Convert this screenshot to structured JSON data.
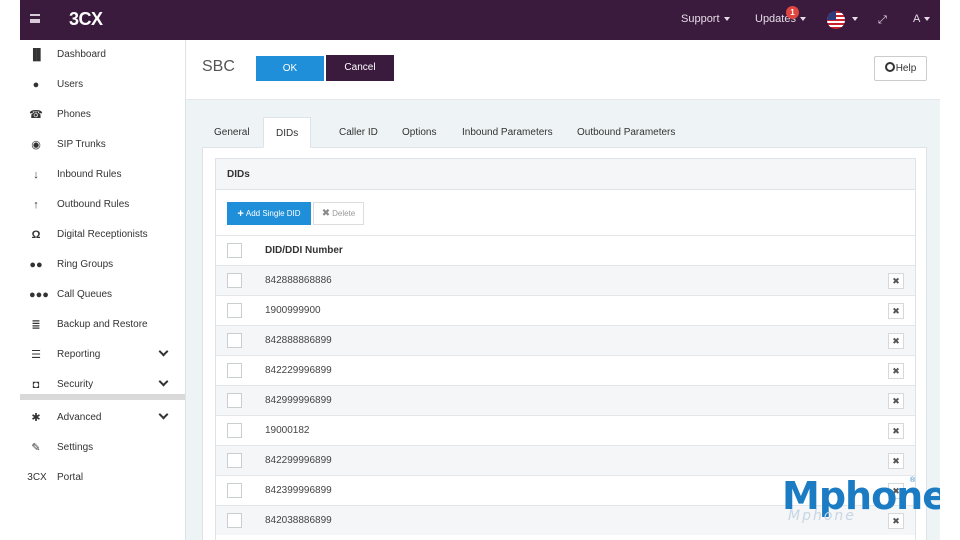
{
  "topbar": {
    "logo": "3CX",
    "support": "Support",
    "updates": "Updates",
    "updates_badge": "1",
    "user": "A",
    "expand_icon": "expand-icon",
    "flag_icon": "us-flag-icon"
  },
  "sidebar": {
    "items": [
      {
        "label": "Dashboard",
        "icon": "bar-chart-icon"
      },
      {
        "label": "Users",
        "icon": "user-icon"
      },
      {
        "label": "Phones",
        "icon": "phone-icon"
      },
      {
        "label": "SIP Trunks",
        "icon": "globe-icon"
      },
      {
        "label": "Inbound Rules",
        "icon": "arrow-down-icon"
      },
      {
        "label": "Outbound Rules",
        "icon": "arrow-up-icon"
      },
      {
        "label": "Digital Receptionists",
        "icon": "headset-icon"
      },
      {
        "label": "Ring Groups",
        "icon": "group-icon"
      },
      {
        "label": "Call Queues",
        "icon": "queue-icon"
      },
      {
        "label": "Backup and Restore",
        "icon": "database-icon"
      },
      {
        "label": "Reporting",
        "icon": "list-icon"
      },
      {
        "label": "Security",
        "icon": "shield-icon"
      },
      {
        "label": "Advanced",
        "icon": "cog-icon"
      },
      {
        "label": "Settings",
        "icon": "wrench-icon"
      },
      {
        "label": "Portal",
        "icon": "3cx-icon",
        "icon_text": "3CX"
      }
    ]
  },
  "page": {
    "title": "SBC",
    "ok": "OK",
    "cancel": "Cancel",
    "help": "Help"
  },
  "tabs": [
    "General",
    "DIDs",
    "Caller ID",
    "Options",
    "Inbound Parameters",
    "Outbound Parameters"
  ],
  "active_tab": "DIDs",
  "dids": {
    "title": "DIDs",
    "add_label": "Add Single DID",
    "delete_label": "Delete",
    "column": "DID/DDI Number",
    "rows": [
      "842888868886",
      "1900999900",
      "842888886899",
      "842229996899",
      "842999996899",
      "19000182",
      "842299996899",
      "842399996899",
      "842038886899"
    ]
  },
  "watermark": {
    "text": "Mphone",
    "reflection": "Mphone",
    "reg": "®"
  },
  "colors": {
    "topbar": "#3a1b3d",
    "primary": "#1e8fd8",
    "cancel": "#3a1b3d",
    "watermark": "#1b7cc4"
  }
}
